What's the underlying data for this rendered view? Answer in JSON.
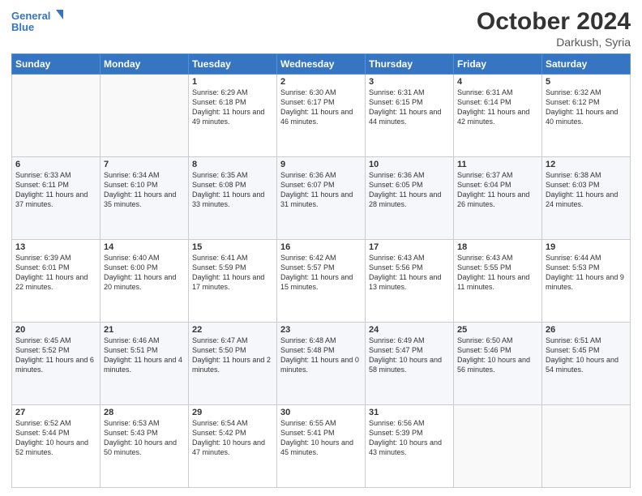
{
  "header": {
    "logo_line1": "General",
    "logo_line2": "Blue",
    "month": "October 2024",
    "location": "Darkush, Syria"
  },
  "days_of_week": [
    "Sunday",
    "Monday",
    "Tuesday",
    "Wednesday",
    "Thursday",
    "Friday",
    "Saturday"
  ],
  "weeks": [
    [
      {
        "num": "",
        "info": ""
      },
      {
        "num": "",
        "info": ""
      },
      {
        "num": "1",
        "info": "Sunrise: 6:29 AM\nSunset: 6:18 PM\nDaylight: 11 hours and 49 minutes."
      },
      {
        "num": "2",
        "info": "Sunrise: 6:30 AM\nSunset: 6:17 PM\nDaylight: 11 hours and 46 minutes."
      },
      {
        "num": "3",
        "info": "Sunrise: 6:31 AM\nSunset: 6:15 PM\nDaylight: 11 hours and 44 minutes."
      },
      {
        "num": "4",
        "info": "Sunrise: 6:31 AM\nSunset: 6:14 PM\nDaylight: 11 hours and 42 minutes."
      },
      {
        "num": "5",
        "info": "Sunrise: 6:32 AM\nSunset: 6:12 PM\nDaylight: 11 hours and 40 minutes."
      }
    ],
    [
      {
        "num": "6",
        "info": "Sunrise: 6:33 AM\nSunset: 6:11 PM\nDaylight: 11 hours and 37 minutes."
      },
      {
        "num": "7",
        "info": "Sunrise: 6:34 AM\nSunset: 6:10 PM\nDaylight: 11 hours and 35 minutes."
      },
      {
        "num": "8",
        "info": "Sunrise: 6:35 AM\nSunset: 6:08 PM\nDaylight: 11 hours and 33 minutes."
      },
      {
        "num": "9",
        "info": "Sunrise: 6:36 AM\nSunset: 6:07 PM\nDaylight: 11 hours and 31 minutes."
      },
      {
        "num": "10",
        "info": "Sunrise: 6:36 AM\nSunset: 6:05 PM\nDaylight: 11 hours and 28 minutes."
      },
      {
        "num": "11",
        "info": "Sunrise: 6:37 AM\nSunset: 6:04 PM\nDaylight: 11 hours and 26 minutes."
      },
      {
        "num": "12",
        "info": "Sunrise: 6:38 AM\nSunset: 6:03 PM\nDaylight: 11 hours and 24 minutes."
      }
    ],
    [
      {
        "num": "13",
        "info": "Sunrise: 6:39 AM\nSunset: 6:01 PM\nDaylight: 11 hours and 22 minutes."
      },
      {
        "num": "14",
        "info": "Sunrise: 6:40 AM\nSunset: 6:00 PM\nDaylight: 11 hours and 20 minutes."
      },
      {
        "num": "15",
        "info": "Sunrise: 6:41 AM\nSunset: 5:59 PM\nDaylight: 11 hours and 17 minutes."
      },
      {
        "num": "16",
        "info": "Sunrise: 6:42 AM\nSunset: 5:57 PM\nDaylight: 11 hours and 15 minutes."
      },
      {
        "num": "17",
        "info": "Sunrise: 6:43 AM\nSunset: 5:56 PM\nDaylight: 11 hours and 13 minutes."
      },
      {
        "num": "18",
        "info": "Sunrise: 6:43 AM\nSunset: 5:55 PM\nDaylight: 11 hours and 11 minutes."
      },
      {
        "num": "19",
        "info": "Sunrise: 6:44 AM\nSunset: 5:53 PM\nDaylight: 11 hours and 9 minutes."
      }
    ],
    [
      {
        "num": "20",
        "info": "Sunrise: 6:45 AM\nSunset: 5:52 PM\nDaylight: 11 hours and 6 minutes."
      },
      {
        "num": "21",
        "info": "Sunrise: 6:46 AM\nSunset: 5:51 PM\nDaylight: 11 hours and 4 minutes."
      },
      {
        "num": "22",
        "info": "Sunrise: 6:47 AM\nSunset: 5:50 PM\nDaylight: 11 hours and 2 minutes."
      },
      {
        "num": "23",
        "info": "Sunrise: 6:48 AM\nSunset: 5:48 PM\nDaylight: 11 hours and 0 minutes."
      },
      {
        "num": "24",
        "info": "Sunrise: 6:49 AM\nSunset: 5:47 PM\nDaylight: 10 hours and 58 minutes."
      },
      {
        "num": "25",
        "info": "Sunrise: 6:50 AM\nSunset: 5:46 PM\nDaylight: 10 hours and 56 minutes."
      },
      {
        "num": "26",
        "info": "Sunrise: 6:51 AM\nSunset: 5:45 PM\nDaylight: 10 hours and 54 minutes."
      }
    ],
    [
      {
        "num": "27",
        "info": "Sunrise: 6:52 AM\nSunset: 5:44 PM\nDaylight: 10 hours and 52 minutes."
      },
      {
        "num": "28",
        "info": "Sunrise: 6:53 AM\nSunset: 5:43 PM\nDaylight: 10 hours and 50 minutes."
      },
      {
        "num": "29",
        "info": "Sunrise: 6:54 AM\nSunset: 5:42 PM\nDaylight: 10 hours and 47 minutes."
      },
      {
        "num": "30",
        "info": "Sunrise: 6:55 AM\nSunset: 5:41 PM\nDaylight: 10 hours and 45 minutes."
      },
      {
        "num": "31",
        "info": "Sunrise: 6:56 AM\nSunset: 5:39 PM\nDaylight: 10 hours and 43 minutes."
      },
      {
        "num": "",
        "info": ""
      },
      {
        "num": "",
        "info": ""
      }
    ]
  ]
}
